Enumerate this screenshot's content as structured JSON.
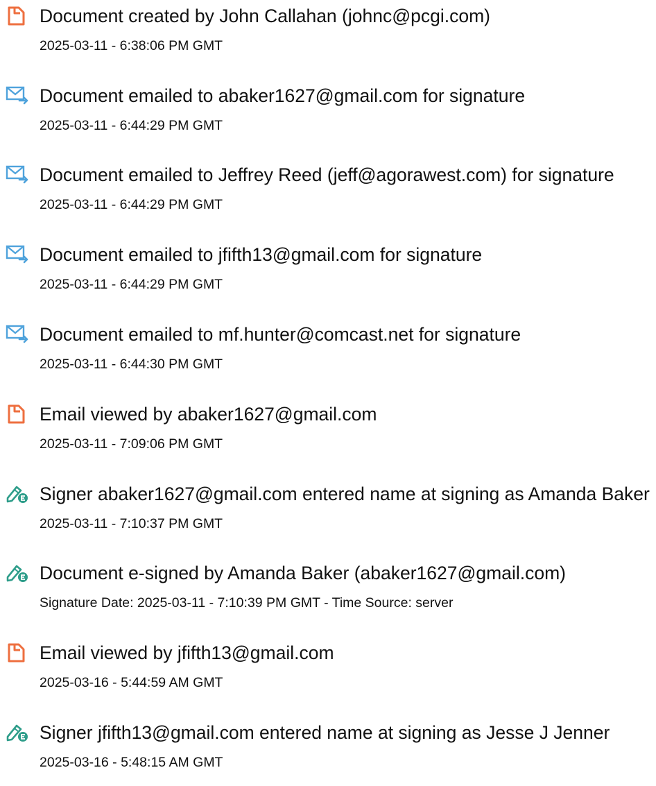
{
  "colors": {
    "doc_icon": "#ee6f3f",
    "email_icon": "#4fa3dc",
    "sign_icon": "#2e9d8a"
  },
  "audit_log": [
    {
      "icon": "document-icon",
      "title": "Document created by John Callahan (johnc@pcgi.com)",
      "timestamp": "2025-03-11 - 6:38:06 PM GMT"
    },
    {
      "icon": "email-icon",
      "title": "Document emailed to abaker1627@gmail.com for signature",
      "timestamp": "2025-03-11 - 6:44:29 PM GMT"
    },
    {
      "icon": "email-icon",
      "title": "Document emailed to Jeffrey Reed (jeff@agorawest.com) for signature",
      "timestamp": "2025-03-11 - 6:44:29 PM GMT"
    },
    {
      "icon": "email-icon",
      "title": "Document emailed to jfifth13@gmail.com for signature",
      "timestamp": "2025-03-11 - 6:44:29 PM GMT"
    },
    {
      "icon": "email-icon",
      "title": "Document emailed to mf.hunter@comcast.net for signature",
      "timestamp": "2025-03-11 - 6:44:30 PM GMT"
    },
    {
      "icon": "document-icon",
      "title": "Email viewed by abaker1627@gmail.com",
      "timestamp": "2025-03-11 - 7:09:06 PM GMT"
    },
    {
      "icon": "esign-icon",
      "title": "Signer abaker1627@gmail.com entered name at signing as Amanda Baker",
      "timestamp": "2025-03-11 - 7:10:37 PM GMT"
    },
    {
      "icon": "esign-icon",
      "title": "Document e-signed by Amanda Baker (abaker1627@gmail.com)",
      "timestamp": "Signature Date: 2025-03-11 - 7:10:39 PM GMT - Time Source: server"
    },
    {
      "icon": "document-icon",
      "title": "Email viewed by jfifth13@gmail.com",
      "timestamp": "2025-03-16 - 5:44:59 AM GMT"
    },
    {
      "icon": "esign-icon",
      "title": "Signer jfifth13@gmail.com entered name at signing as Jesse J Jenner",
      "timestamp": "2025-03-16 - 5:48:15 AM GMT"
    }
  ]
}
